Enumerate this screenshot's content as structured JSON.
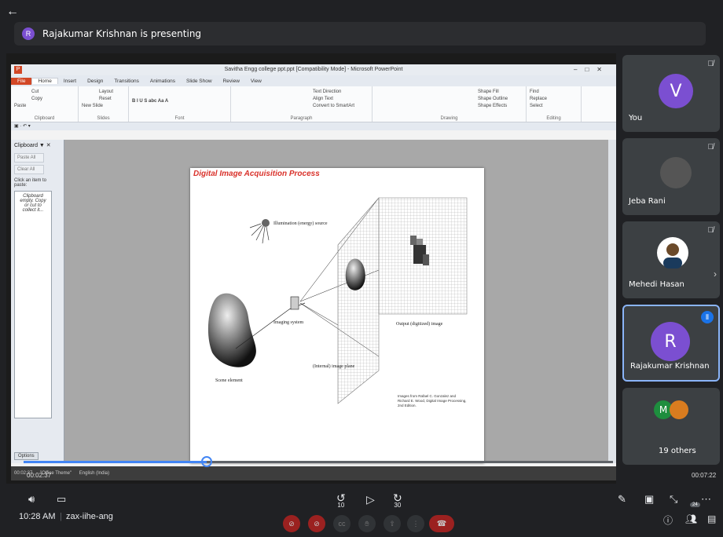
{
  "header": {
    "presenter_initial": "R",
    "presenting_text": "Rajakumar Krishnan is presenting"
  },
  "ppt": {
    "window_title": "Savitha Engg college ppt.ppt [Compatibility Mode] - Microsoft PowerPoint",
    "tabs": [
      "File",
      "Home",
      "Insert",
      "Design",
      "Transitions",
      "Animations",
      "Slide Show",
      "Review",
      "View"
    ],
    "ribbon": {
      "clipboard": {
        "cut": "Cut",
        "copy": "Copy",
        "paste": "Paste",
        "format_painter": "Format Painter",
        "label": "Clipboard"
      },
      "slides": {
        "new_slide": "New Slide",
        "layout": "Layout",
        "reset": "Reset",
        "section": "Section",
        "label": "Slides"
      },
      "font": {
        "label": "Font"
      },
      "paragraph": {
        "text_direction": "Text Direction",
        "align_text": "Align Text",
        "convert_smartart": "Convert to SmartArt",
        "label": "Paragraph"
      },
      "drawing": {
        "arrange": "Arrange",
        "quick_styles": "Quick Styles",
        "shape_fill": "Shape Fill",
        "shape_outline": "Shape Outline",
        "shape_effects": "Shape Effects",
        "label": "Drawing"
      },
      "editing": {
        "find": "Find",
        "replace": "Replace",
        "select": "Select",
        "label": "Editing"
      }
    },
    "clipboard_pane": {
      "title": "Clipboard",
      "paste_all": "Paste All",
      "clear_all": "Clear All",
      "hint": "Click an item to paste:",
      "empty_msg": "Clipboard empty. Copy or cut to collect it...",
      "options": "Options"
    },
    "slide": {
      "title": "Digital Image Acquisition Process",
      "labels": {
        "illumination": "Illumination (energy) source",
        "imaging_system": "Imaging system",
        "image_plane": "(Internal) image plane",
        "output": "Output (digitized) image",
        "scene": "Scene element"
      },
      "credit": "Images from Rafael C. Gonzalez and Richard E. Wood, Digital Image Processing, 2nd Edition."
    },
    "status": {
      "slide_info": "00:02:37",
      "theme": "\"Office Theme\"",
      "language": "English (India)"
    }
  },
  "video": {
    "elapsed": "00:02:37",
    "total": "00:07:22",
    "progress": 0.31
  },
  "participants": [
    {
      "name": "You",
      "initial": "V",
      "color": "#7b4fd1",
      "muted": true
    },
    {
      "name": "Jeba Rani",
      "muted": true
    },
    {
      "name": "Mehedi Hasan",
      "muted": true
    },
    {
      "name": "Rajakumar Krishnan",
      "initial": "R",
      "color": "#7b4fd1",
      "speaking": true
    },
    {
      "name": "19 others",
      "initial": "M",
      "color": "#1e8e3e"
    }
  ],
  "bottom": {
    "time": "10:28 AM",
    "meeting_code": "zax-iihe-ang",
    "rewind_seconds": "10",
    "forward_seconds": "30",
    "people_count": "24"
  }
}
